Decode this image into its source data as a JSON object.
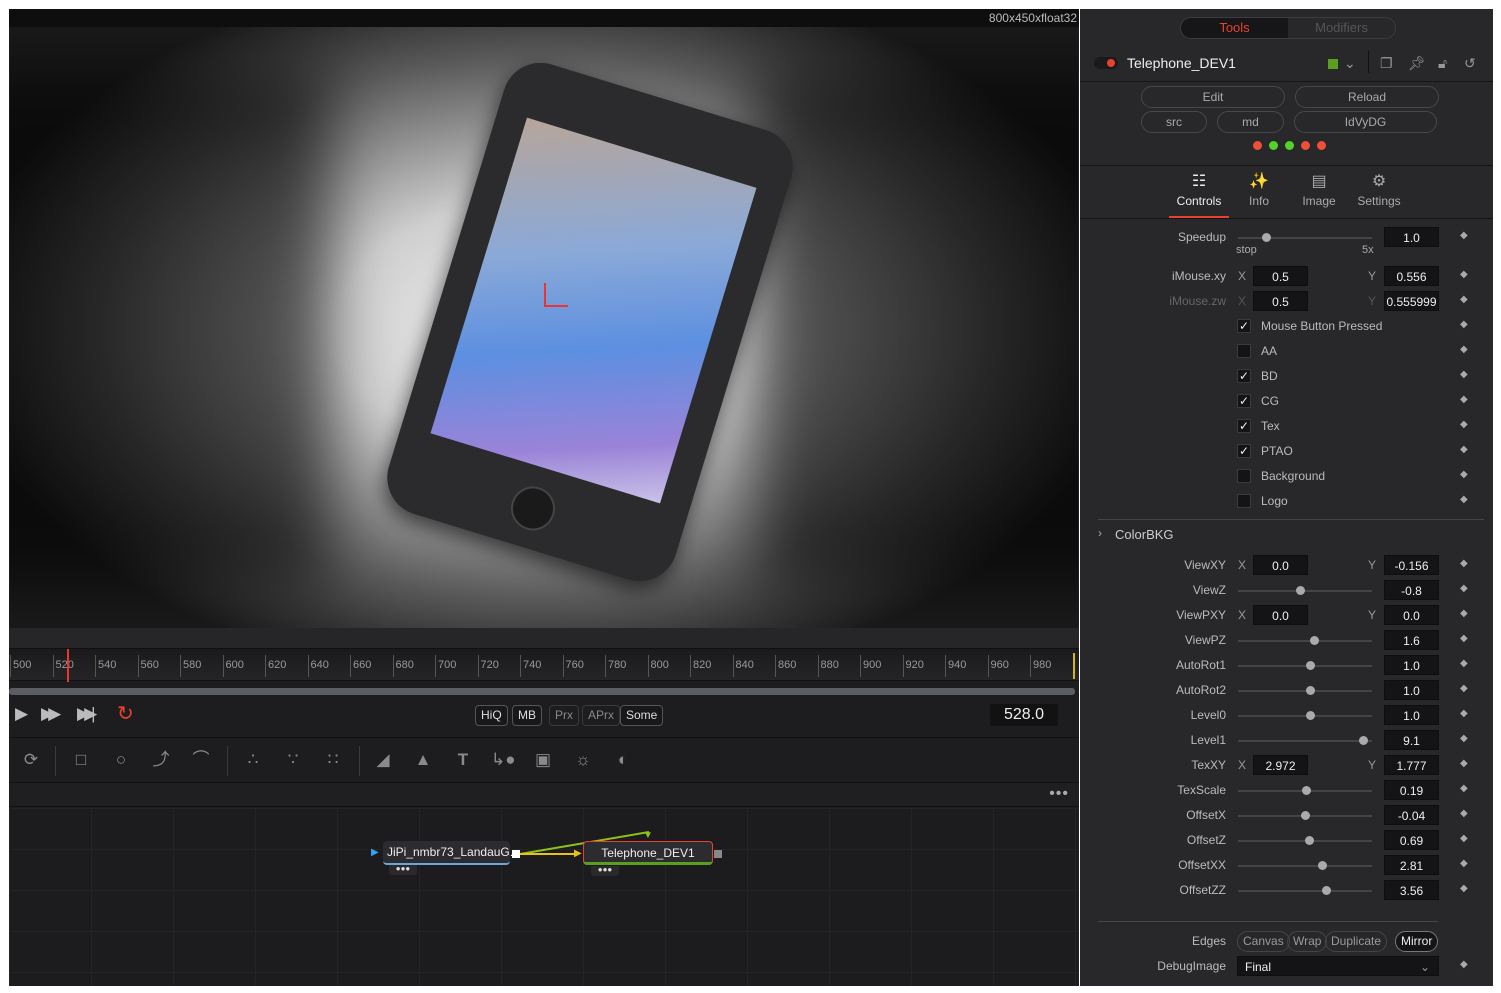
{
  "viewer": {
    "resolution": "800x450xfloat32"
  },
  "timeline": {
    "ticks": [
      500,
      520,
      540,
      560,
      580,
      600,
      620,
      640,
      660,
      680,
      700,
      720,
      740,
      760,
      780,
      800,
      820,
      840,
      860,
      880,
      900,
      920,
      940,
      960,
      980
    ],
    "current_frame": "528.0",
    "playhead": 527
  },
  "transport": {
    "quality_buttons": [
      {
        "label": "HiQ",
        "on": true
      },
      {
        "label": "MB",
        "on": true
      },
      {
        "label": "Prx",
        "on": false
      },
      {
        "label": "APrx",
        "on": false
      },
      {
        "label": "Some",
        "on": true
      }
    ]
  },
  "nodes": {
    "source": "JiPi_nmbr73_LandauG...",
    "target": "Telephone_DEV1"
  },
  "panel": {
    "tabs_top": {
      "tools": "Tools",
      "modifiers": "Modifiers"
    },
    "tool_name": "Telephone_DEV1",
    "tool_color": "#5a9e1e",
    "buttons": {
      "edit": "Edit",
      "reload": "Reload",
      "src": "src",
      "md": "md",
      "idvydg": "IdVyDG"
    },
    "leds": [
      "#f0503a",
      "#52d22a",
      "#52d22a",
      "#f0503a",
      "#f0503a"
    ],
    "tabs": [
      {
        "label": "Controls",
        "icon": "sliders-icon"
      },
      {
        "label": "Info",
        "icon": "info-wand-icon"
      },
      {
        "label": "Image",
        "icon": "image-icon"
      },
      {
        "label": "Settings",
        "icon": "settings-icon"
      }
    ],
    "group1": [
      {
        "type": "slider",
        "label": "Speedup",
        "level": 0.21,
        "value": "1.0",
        "min_label": "stop",
        "max_label": "5x"
      },
      {
        "type": "xy",
        "label": "iMouse.xy",
        "x": "0.5",
        "y": "0.556"
      },
      {
        "type": "xy",
        "label": "iMouse.zw",
        "x": "0.5",
        "y": "0.555999",
        "dim": true
      },
      {
        "type": "check",
        "label": "Mouse Button Pressed",
        "checked": true
      },
      {
        "type": "check",
        "label": "AA",
        "checked": false
      },
      {
        "type": "check",
        "label": "BD",
        "checked": true
      },
      {
        "type": "check",
        "label": "CG",
        "checked": true
      },
      {
        "type": "check",
        "label": "Tex",
        "checked": true
      },
      {
        "type": "check",
        "label": "PTAO",
        "checked": true
      },
      {
        "type": "check",
        "label": "Background",
        "checked": false
      },
      {
        "type": "check",
        "label": "Logo",
        "checked": false
      }
    ],
    "section": "ColorBKG",
    "group2": [
      {
        "type": "xy",
        "label": "ViewXY",
        "x": "0.0",
        "y": "-0.156"
      },
      {
        "type": "slider",
        "label": "ViewZ",
        "level": 0.46,
        "value": "-0.8"
      },
      {
        "type": "xy",
        "label": "ViewPXY",
        "x": "0.0",
        "y": "0.0"
      },
      {
        "type": "slider",
        "label": "ViewPZ",
        "level": 0.57,
        "value": "1.6"
      },
      {
        "type": "slider",
        "label": "AutoRot1",
        "level": 0.54,
        "value": "1.0"
      },
      {
        "type": "slider",
        "label": "AutoRot2",
        "level": 0.54,
        "value": "1.0"
      },
      {
        "type": "slider",
        "label": "Level0",
        "level": 0.54,
        "value": "1.0"
      },
      {
        "type": "slider",
        "label": "Level1",
        "level": 0.93,
        "value": "9.1"
      },
      {
        "type": "xy",
        "label": "TexXY",
        "x": "2.972",
        "y": "1.777"
      },
      {
        "type": "slider",
        "label": "TexScale",
        "level": 0.51,
        "value": "0.19"
      },
      {
        "type": "slider",
        "label": "OffsetX",
        "level": 0.5,
        "value": "-0.04"
      },
      {
        "type": "slider",
        "label": "OffsetZ",
        "level": 0.53,
        "value": "0.69"
      },
      {
        "type": "slider",
        "label": "OffsetXX",
        "level": 0.63,
        "value": "2.81"
      },
      {
        "type": "slider",
        "label": "OffsetZZ",
        "level": 0.66,
        "value": "3.56"
      }
    ],
    "edges": {
      "label": "Edges",
      "options": [
        "Canvas",
        "Wrap",
        "Duplicate",
        "Mirror"
      ],
      "selected": "Mirror"
    },
    "debug": {
      "label": "DebugImage",
      "value": "Final"
    },
    "axis_x": "X",
    "axis_y": "Y"
  }
}
